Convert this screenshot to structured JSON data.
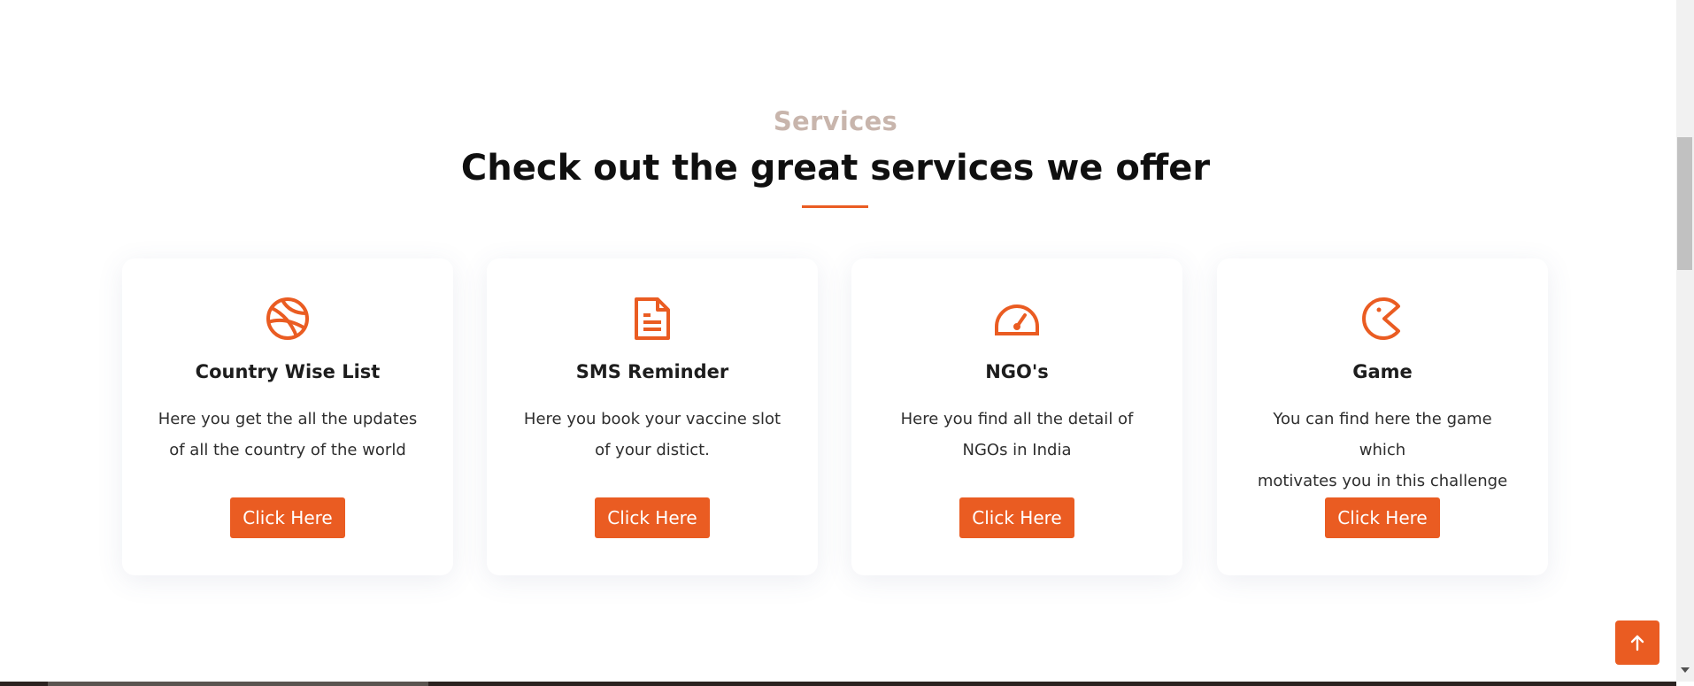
{
  "section": {
    "subtitle": "Services",
    "title": "Check out the great services we offer"
  },
  "cards": [
    {
      "icon": "basketball-icon",
      "title": "Country Wise List",
      "line1": "Here you get the all the updates",
      "line2": "of all the country of the world",
      "button": "Click Here"
    },
    {
      "icon": "document-icon",
      "title": "SMS Reminder",
      "line1": "Here you book your vaccine slot",
      "line2": "of your distict.",
      "button": "Click Here"
    },
    {
      "icon": "speedometer-icon",
      "title": "NGO's",
      "line1": "Here you find all the detail of",
      "line2": "NGOs in India",
      "button": "Click Here"
    },
    {
      "icon": "pacman-icon",
      "title": "Game",
      "line1": "You can find here the game which",
      "line2": "motivates you in this challenge",
      "button": "Click Here"
    }
  ],
  "back_to_top": {
    "icon": "arrow-up-icon"
  },
  "colors": {
    "accent": "#ea5c22",
    "subtitle": "#c8b5ac",
    "title": "#0f0f0f"
  }
}
